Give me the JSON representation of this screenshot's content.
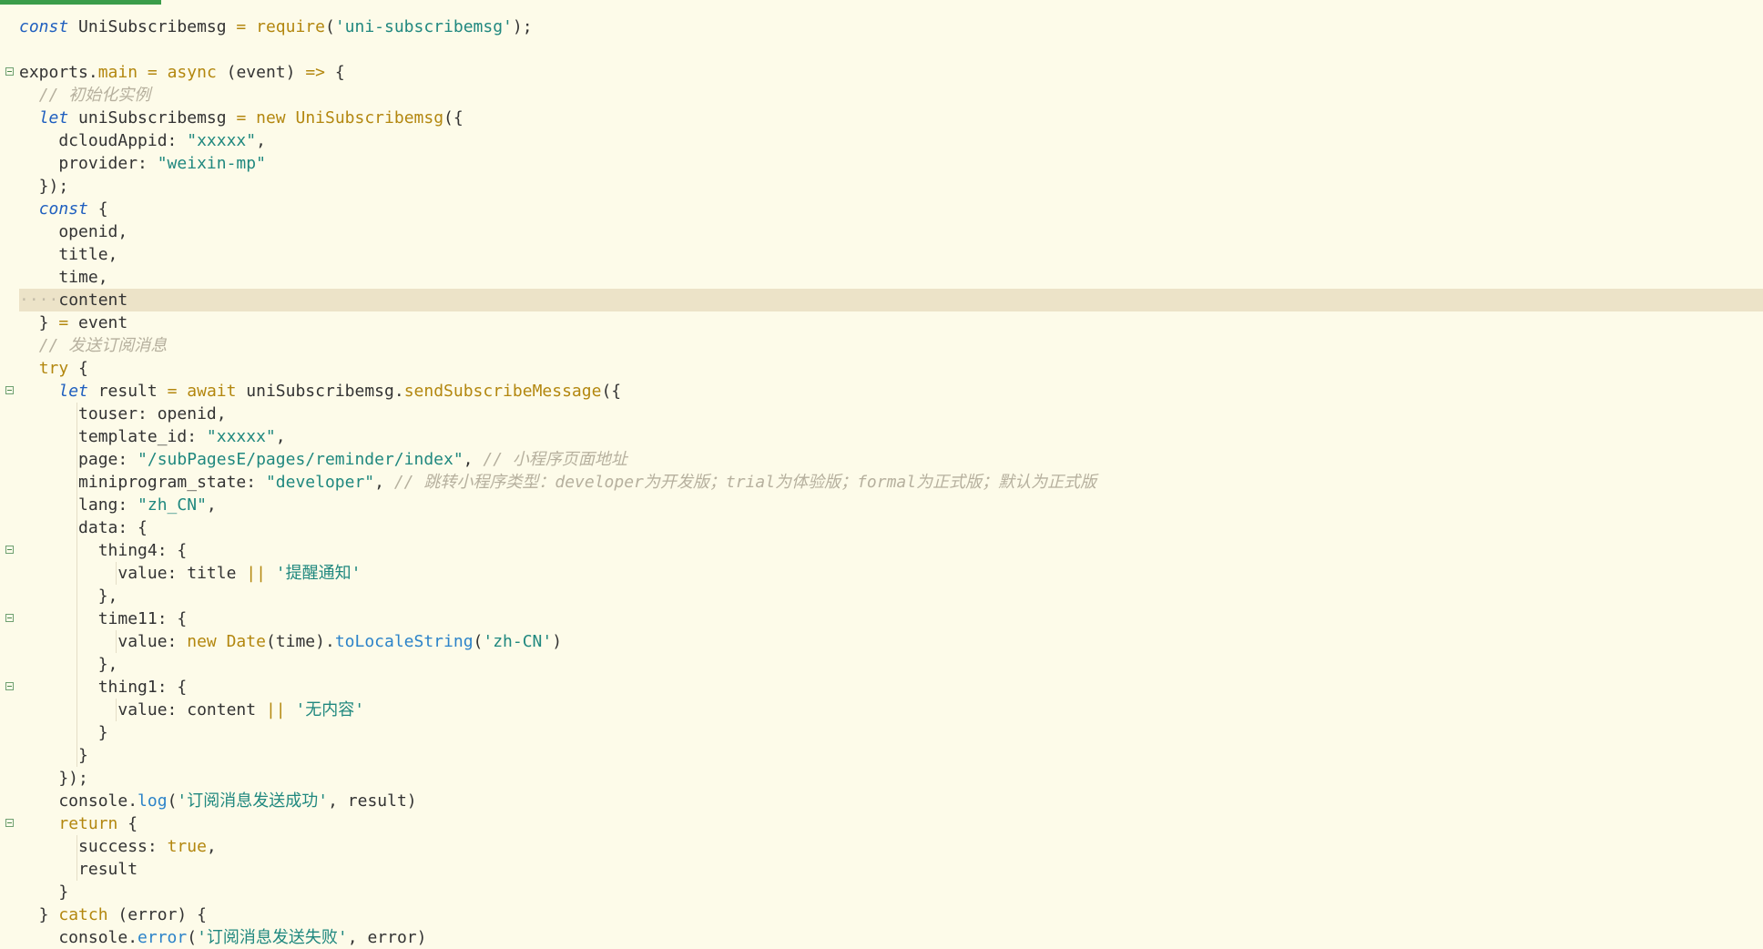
{
  "editor": {
    "lines": [
      {
        "fold": false,
        "guides": [],
        "tokens": [
          {
            "c": "kw",
            "t": "const"
          },
          {
            "c": "id",
            "t": " UniSubscribemsg "
          },
          {
            "c": "op",
            "t": "="
          },
          {
            "c": "id",
            "t": " "
          },
          {
            "c": "fn",
            "t": "require"
          },
          {
            "c": "id",
            "t": "("
          },
          {
            "c": "str",
            "t": "'uni-subscribemsg'"
          },
          {
            "c": "id",
            "t": ");"
          }
        ]
      },
      {
        "fold": false,
        "guides": [],
        "tokens": []
      },
      {
        "fold": true,
        "guides": [],
        "tokens": [
          {
            "c": "id",
            "t": "exports."
          },
          {
            "c": "kw2",
            "t": "main"
          },
          {
            "c": "id",
            "t": " "
          },
          {
            "c": "op",
            "t": "="
          },
          {
            "c": "id",
            "t": " "
          },
          {
            "c": "kw2",
            "t": "async"
          },
          {
            "c": "id",
            "t": " (event) "
          },
          {
            "c": "op",
            "t": "=>"
          },
          {
            "c": "id",
            "t": " {"
          }
        ]
      },
      {
        "fold": false,
        "guides": [],
        "tokens": [
          {
            "c": "id",
            "t": "  "
          },
          {
            "c": "cmt",
            "t": "// 初始化实例"
          }
        ]
      },
      {
        "fold": false,
        "guides": [],
        "tokens": [
          {
            "c": "id",
            "t": "  "
          },
          {
            "c": "kw",
            "t": "let"
          },
          {
            "c": "id",
            "t": " uniSubscribemsg "
          },
          {
            "c": "op",
            "t": "="
          },
          {
            "c": "id",
            "t": " "
          },
          {
            "c": "kw2",
            "t": "new"
          },
          {
            "c": "id",
            "t": " "
          },
          {
            "c": "ty",
            "t": "UniSubscribemsg"
          },
          {
            "c": "id",
            "t": "({"
          }
        ]
      },
      {
        "fold": false,
        "guides": [],
        "tokens": [
          {
            "c": "id",
            "t": "    dcloudAppid: "
          },
          {
            "c": "str",
            "t": "\"xxxxx\""
          },
          {
            "c": "id",
            "t": ","
          }
        ]
      },
      {
        "fold": false,
        "guides": [],
        "tokens": [
          {
            "c": "id",
            "t": "    provider: "
          },
          {
            "c": "str",
            "t": "\"weixin-mp\""
          }
        ]
      },
      {
        "fold": false,
        "guides": [],
        "tokens": [
          {
            "c": "id",
            "t": "  });"
          }
        ]
      },
      {
        "fold": false,
        "guides": [],
        "tokens": [
          {
            "c": "id",
            "t": "  "
          },
          {
            "c": "kw",
            "t": "const"
          },
          {
            "c": "id",
            "t": " {"
          }
        ]
      },
      {
        "fold": false,
        "guides": [],
        "tokens": [
          {
            "c": "id",
            "t": "    openid,"
          }
        ]
      },
      {
        "fold": false,
        "guides": [],
        "tokens": [
          {
            "c": "id",
            "t": "    title,"
          }
        ]
      },
      {
        "fold": false,
        "guides": [],
        "tokens": [
          {
            "c": "id",
            "t": "    time,"
          }
        ]
      },
      {
        "fold": false,
        "guides": [],
        "highlight": true,
        "tokens": [
          {
            "c": "ws",
            "t": "····"
          },
          {
            "c": "id",
            "t": "content"
          }
        ]
      },
      {
        "fold": false,
        "guides": [],
        "tokens": [
          {
            "c": "id",
            "t": "  } "
          },
          {
            "c": "op",
            "t": "="
          },
          {
            "c": "id",
            "t": " event"
          }
        ]
      },
      {
        "fold": false,
        "guides": [],
        "tokens": [
          {
            "c": "id",
            "t": "  "
          },
          {
            "c": "cmt",
            "t": "// 发送订阅消息"
          }
        ]
      },
      {
        "fold": false,
        "guides": [],
        "tokens": [
          {
            "c": "id",
            "t": "  "
          },
          {
            "c": "kw2",
            "t": "try"
          },
          {
            "c": "id",
            "t": " {"
          }
        ]
      },
      {
        "fold": true,
        "guides": [],
        "tokens": [
          {
            "c": "id",
            "t": "    "
          },
          {
            "c": "kw",
            "t": "let"
          },
          {
            "c": "id",
            "t": " result "
          },
          {
            "c": "op",
            "t": "="
          },
          {
            "c": "id",
            "t": " "
          },
          {
            "c": "kw2",
            "t": "await"
          },
          {
            "c": "id",
            "t": " uniSubscribemsg."
          },
          {
            "c": "fn",
            "t": "sendSubscribeMessage"
          },
          {
            "c": "id",
            "t": "({"
          }
        ]
      },
      {
        "fold": false,
        "guides": [
          6
        ],
        "tokens": [
          {
            "c": "id",
            "t": "      touser: openid,"
          }
        ]
      },
      {
        "fold": false,
        "guides": [
          6
        ],
        "tokens": [
          {
            "c": "id",
            "t": "      template_id: "
          },
          {
            "c": "str",
            "t": "\"xxxxx\""
          },
          {
            "c": "id",
            "t": ","
          }
        ]
      },
      {
        "fold": false,
        "guides": [
          6
        ],
        "tokens": [
          {
            "c": "id",
            "t": "      page: "
          },
          {
            "c": "str",
            "t": "\"/subPagesE/pages/reminder/index\""
          },
          {
            "c": "id",
            "t": ", "
          },
          {
            "c": "cmt",
            "t": "// 小程序页面地址"
          }
        ]
      },
      {
        "fold": false,
        "guides": [
          6
        ],
        "tokens": [
          {
            "c": "id",
            "t": "      miniprogram_state: "
          },
          {
            "c": "str",
            "t": "\"developer\""
          },
          {
            "c": "id",
            "t": ", "
          },
          {
            "c": "cmt",
            "t": "// 跳转小程序类型：developer为开发版；trial为体验版；formal为正式版；默认为正式版"
          }
        ]
      },
      {
        "fold": false,
        "guides": [
          6
        ],
        "tokens": [
          {
            "c": "id",
            "t": "      lang: "
          },
          {
            "c": "str",
            "t": "\"zh_CN\""
          },
          {
            "c": "id",
            "t": ","
          }
        ]
      },
      {
        "fold": false,
        "guides": [
          6
        ],
        "tokens": [
          {
            "c": "id",
            "t": "      data: {"
          }
        ]
      },
      {
        "fold": true,
        "guides": [
          6
        ],
        "tokens": [
          {
            "c": "id",
            "t": "        thing4: {"
          }
        ]
      },
      {
        "fold": false,
        "guides": [
          6,
          10
        ],
        "tokens": [
          {
            "c": "id",
            "t": "          value: title "
          },
          {
            "c": "op",
            "t": "||"
          },
          {
            "c": "id",
            "t": " "
          },
          {
            "c": "str",
            "t": "'提醒通知'"
          }
        ]
      },
      {
        "fold": false,
        "guides": [
          6
        ],
        "tokens": [
          {
            "c": "id",
            "t": "        },"
          }
        ]
      },
      {
        "fold": true,
        "guides": [
          6
        ],
        "tokens": [
          {
            "c": "id",
            "t": "        time11: {"
          }
        ]
      },
      {
        "fold": false,
        "guides": [
          6,
          10
        ],
        "tokens": [
          {
            "c": "id",
            "t": "          value: "
          },
          {
            "c": "kw2",
            "t": "new"
          },
          {
            "c": "id",
            "t": " "
          },
          {
            "c": "ty",
            "t": "Date"
          },
          {
            "c": "id",
            "t": "(time)."
          },
          {
            "c": "mth",
            "t": "toLocaleString"
          },
          {
            "c": "id",
            "t": "("
          },
          {
            "c": "str",
            "t": "'zh-CN'"
          },
          {
            "c": "id",
            "t": ")"
          }
        ]
      },
      {
        "fold": false,
        "guides": [
          6
        ],
        "tokens": [
          {
            "c": "id",
            "t": "        },"
          }
        ]
      },
      {
        "fold": true,
        "guides": [
          6
        ],
        "tokens": [
          {
            "c": "id",
            "t": "        thing1: {"
          }
        ]
      },
      {
        "fold": false,
        "guides": [
          6,
          10
        ],
        "tokens": [
          {
            "c": "id",
            "t": "          value: content "
          },
          {
            "c": "op",
            "t": "||"
          },
          {
            "c": "id",
            "t": " "
          },
          {
            "c": "str",
            "t": "'无内容'"
          }
        ]
      },
      {
        "fold": false,
        "guides": [
          6
        ],
        "tokens": [
          {
            "c": "id",
            "t": "        }"
          }
        ]
      },
      {
        "fold": false,
        "guides": [
          6
        ],
        "tokens": [
          {
            "c": "id",
            "t": "      }"
          }
        ]
      },
      {
        "fold": false,
        "guides": [],
        "tokens": [
          {
            "c": "id",
            "t": "    });"
          }
        ]
      },
      {
        "fold": false,
        "guides": [],
        "tokens": [
          {
            "c": "id",
            "t": "    console."
          },
          {
            "c": "mth",
            "t": "log"
          },
          {
            "c": "id",
            "t": "("
          },
          {
            "c": "str",
            "t": "'订阅消息发送成功'"
          },
          {
            "c": "id",
            "t": ", result)"
          }
        ]
      },
      {
        "fold": true,
        "guides": [],
        "tokens": [
          {
            "c": "id",
            "t": "    "
          },
          {
            "c": "kw2",
            "t": "return"
          },
          {
            "c": "id",
            "t": " {"
          }
        ]
      },
      {
        "fold": false,
        "guides": [
          6
        ],
        "tokens": [
          {
            "c": "id",
            "t": "      success: "
          },
          {
            "c": "kw2",
            "t": "true"
          },
          {
            "c": "id",
            "t": ","
          }
        ]
      },
      {
        "fold": false,
        "guides": [
          6
        ],
        "tokens": [
          {
            "c": "id",
            "t": "      result"
          }
        ]
      },
      {
        "fold": false,
        "guides": [],
        "tokens": [
          {
            "c": "id",
            "t": "    }"
          }
        ]
      },
      {
        "fold": false,
        "guides": [],
        "tokens": [
          {
            "c": "id",
            "t": "  } "
          },
          {
            "c": "kw2",
            "t": "catch"
          },
          {
            "c": "id",
            "t": " (error) {"
          }
        ]
      },
      {
        "fold": false,
        "guides": [],
        "tokens": [
          {
            "c": "id",
            "t": "    console."
          },
          {
            "c": "mth",
            "t": "error"
          },
          {
            "c": "id",
            "t": "("
          },
          {
            "c": "str",
            "t": "'订阅消息发送失败'"
          },
          {
            "c": "id",
            "t": ", error)"
          }
        ]
      }
    ]
  }
}
